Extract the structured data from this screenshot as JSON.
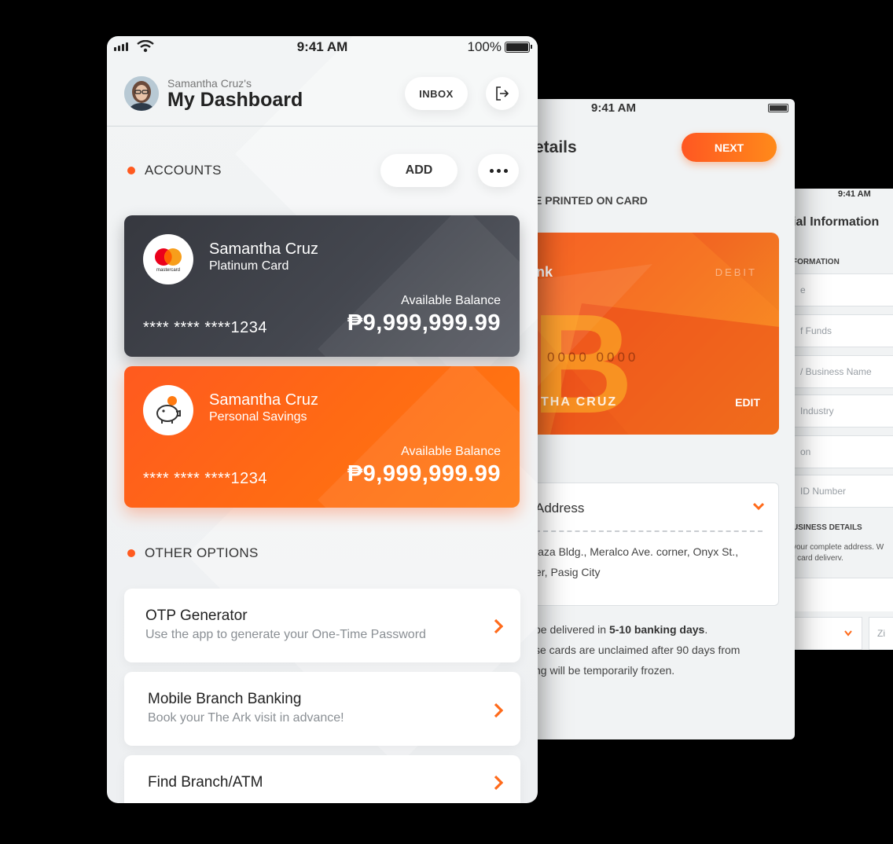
{
  "screen3": {
    "time": "9:41 AM",
    "title": "ial Information",
    "section1": "FORMATION",
    "fields": [
      "e",
      "f Funds",
      "/ Business Name",
      "Industry",
      "on",
      "ID Number"
    ],
    "section2": "USINESS DETAILS",
    "note_lines": [
      "your complete address. W",
      "r card deliverv."
    ],
    "zip_placeholder": "Zi"
  },
  "screen2": {
    "time": "9:41 AM",
    "title": "etails",
    "next_label": "NEXT",
    "printed_label": "E PRINTED ON CARD",
    "card": {
      "brand": "nk",
      "debit": "DEBIT",
      "number": "0000   0000",
      "name": "THA CRUZ",
      "edit_label": "EDIT"
    },
    "address": {
      "title": "Address",
      "line1": "laza Bldg., Meralco Ave. corner, Onyx St.,",
      "line2": "er, Pasig City"
    },
    "info": {
      "line1_pre": "be delivered in ",
      "line1_bold": "5-10 banking days",
      "line1_post": ".",
      "line2": "se cards are unclaimed after 90 days from",
      "line3": "ng will be temporarily frozen."
    }
  },
  "screen1": {
    "status": {
      "time": "9:41 AM",
      "battery": "100%"
    },
    "header": {
      "subtitle": "Samantha Cruz's",
      "title": "My Dashboard",
      "inbox_label": "INBOX"
    },
    "accounts": {
      "section_label": "ACCOUNTS",
      "add_label": "ADD",
      "cards": [
        {
          "holder": "Samantha Cruz",
          "type": "Platinum Card",
          "number": "**** **** ****1234",
          "balance_label": "Available Balance",
          "balance": "₱9,999,999.99",
          "logo_text": "mastercard"
        },
        {
          "holder": "Samantha Cruz",
          "type": "Personal Savings",
          "number": "**** **** ****1234",
          "balance_label": "Available Balance",
          "balance": "₱9,999,999.99"
        }
      ]
    },
    "other_options": {
      "section_label": "OTHER OPTIONS",
      "items": [
        {
          "title": "OTP Generator",
          "subtitle": "Use the app to generate your One-Time Password"
        },
        {
          "title": "Mobile Branch Banking",
          "subtitle": "Book your The Ark visit in advance!"
        },
        {
          "title": "Find Branch/ATM"
        }
      ]
    },
    "colors": {
      "accent": "#ff5a1f",
      "dark_card": "#3a3c43"
    }
  }
}
